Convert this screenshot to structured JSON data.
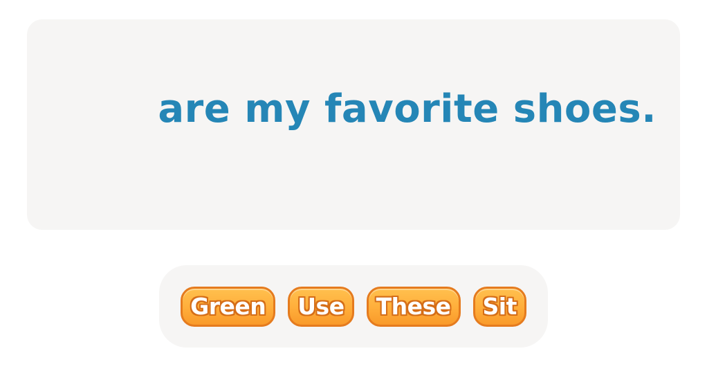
{
  "sentence": {
    "text": "are my favorite shoes."
  },
  "word_bank": {
    "options": [
      {
        "label": "Green"
      },
      {
        "label": "Use"
      },
      {
        "label": "These"
      },
      {
        "label": "Sit"
      }
    ]
  },
  "colors": {
    "sentence_text": "#2586b6",
    "panel_background": "#f6f5f4",
    "chip_fill": "#ffad3a",
    "chip_border": "#e57b1e"
  }
}
